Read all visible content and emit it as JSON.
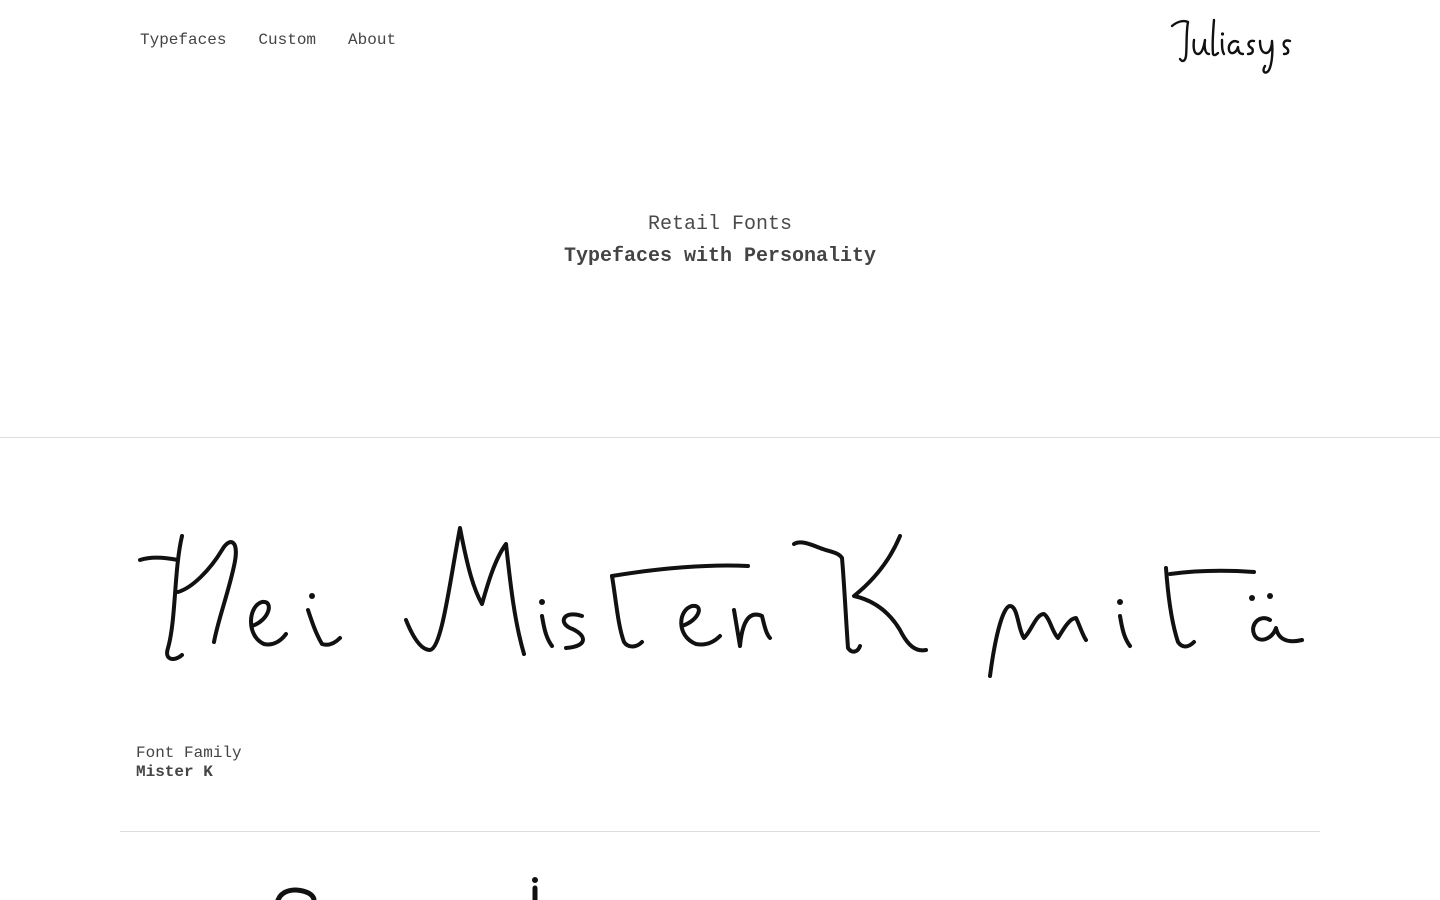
{
  "nav": {
    "items": [
      {
        "label": "Typefaces"
      },
      {
        "label": "Custom"
      },
      {
        "label": "About"
      }
    ]
  },
  "logo": {
    "text": "Juliasys",
    "icon": "handwritten-logo"
  },
  "hero": {
    "kicker": "Retail Fonts",
    "title": "Typefaces with Personality"
  },
  "specimens": [
    {
      "sample_text": "Hei Mister K mitä",
      "label": "Font Family",
      "name": "Mister K"
    }
  ],
  "colors": {
    "text": "#444444",
    "ink": "#111111",
    "divider": "#dddddd",
    "background": "#ffffff"
  }
}
